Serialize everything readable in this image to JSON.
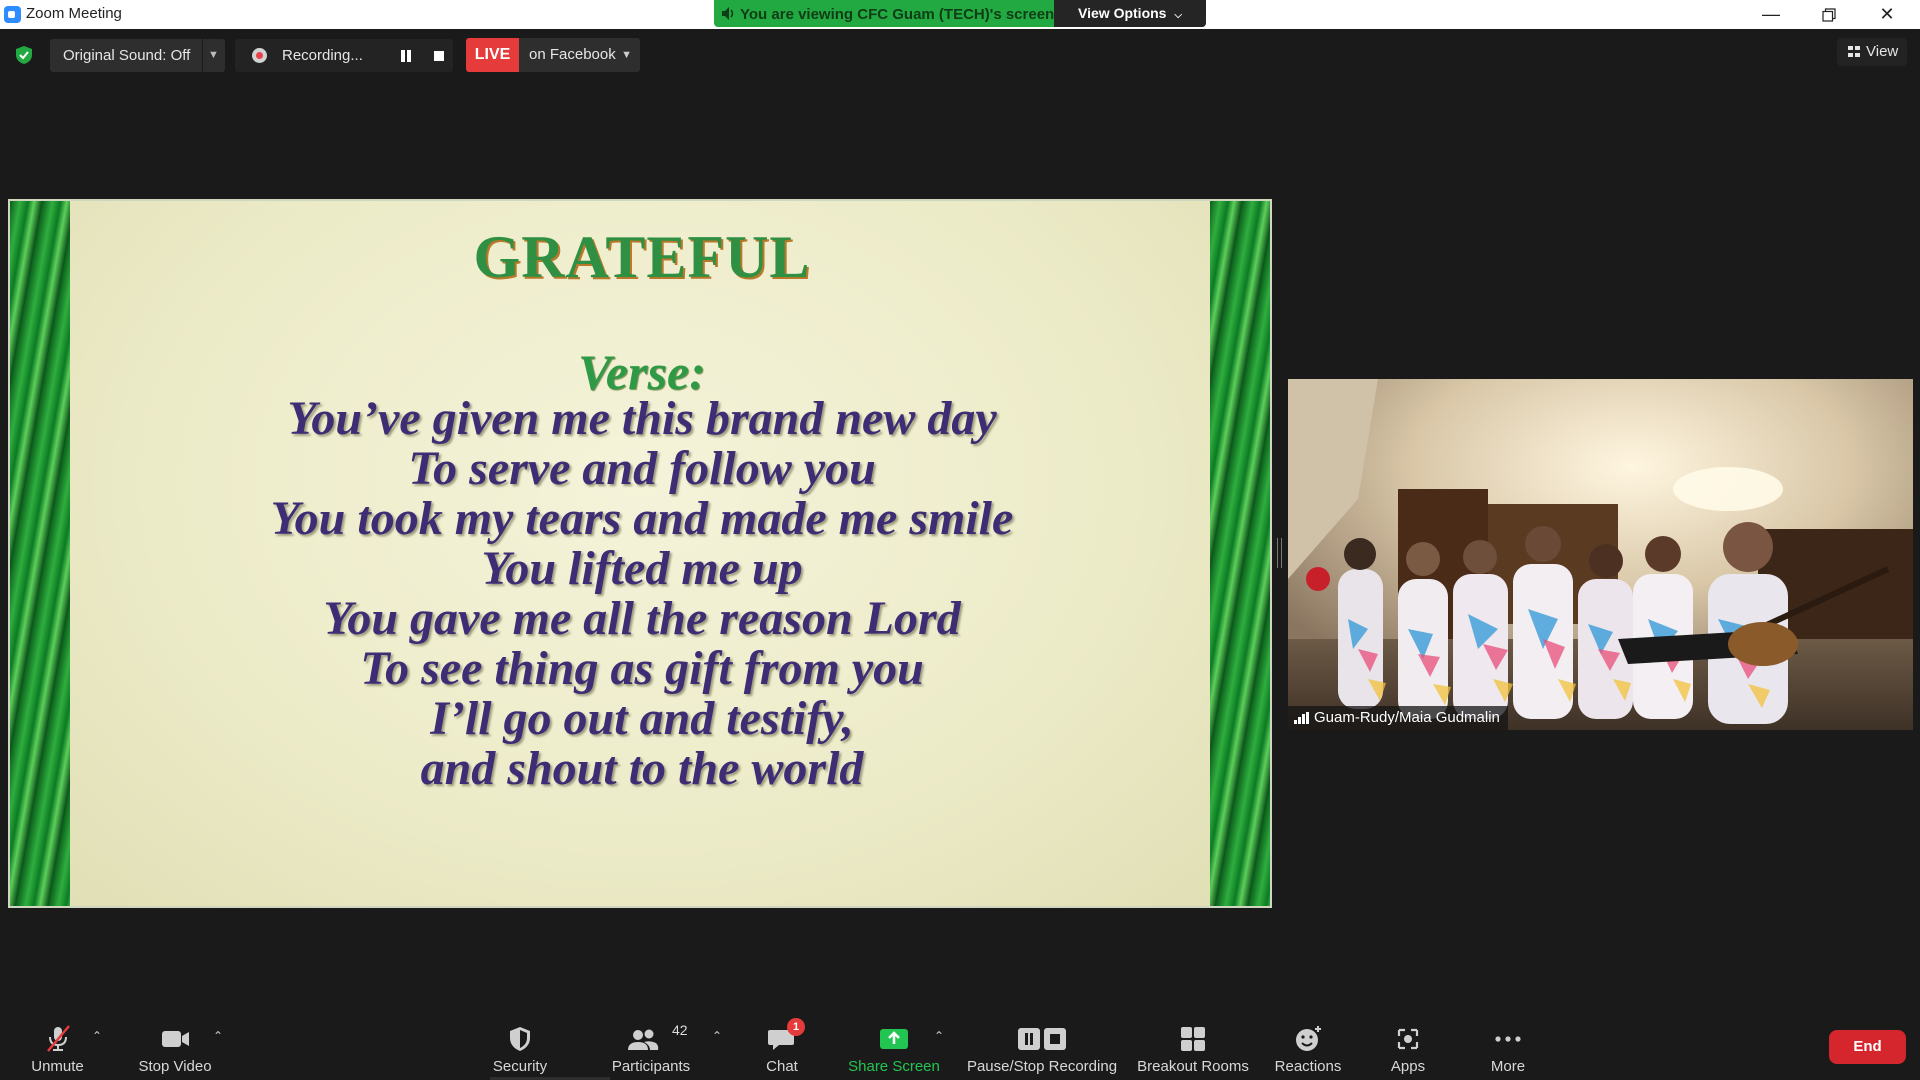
{
  "window": {
    "title": "Zoom Meeting",
    "minimize_icon": "minimize-icon",
    "restore_icon": "restore-icon",
    "close_icon": "close-icon"
  },
  "banner": {
    "message": "You are viewing CFC Guam (TECH)'s screen",
    "view_options": "View Options",
    "color": "#23a942"
  },
  "top_bar": {
    "original_sound": "Original Sound: Off",
    "recording_label": "Recording...",
    "live_badge": "LIVE",
    "live_target": "on Facebook",
    "view_button": "View"
  },
  "slide": {
    "title": "GRATEFUL",
    "verse_label": "Verse:",
    "lines": [
      "You’ve given me this brand new day",
      "To serve and follow you",
      "You took my tears and made me smile",
      "You lifted me up",
      "You gave me all the reason Lord",
      "To see thing as gift from you",
      "I’ll go out and testify,",
      "and shout to the world"
    ]
  },
  "video": {
    "participant_name": "Guam-Rudy/Maia Gudmalin"
  },
  "toolbar": {
    "unmute": "Unmute",
    "stop_video": "Stop Video",
    "security": "Security",
    "participants": "Participants",
    "participants_count": "42",
    "chat": "Chat",
    "chat_unread": "1",
    "share_screen": "Share Screen",
    "pause_stop_recording": "Pause/Stop Recording",
    "breakout_rooms": "Breakout Rooms",
    "reactions": "Reactions",
    "apps": "Apps",
    "more": "More",
    "end": "End"
  },
  "colors": {
    "share_green": "#23c552",
    "end_red": "#d5262d",
    "live_red": "#e53b3b"
  }
}
